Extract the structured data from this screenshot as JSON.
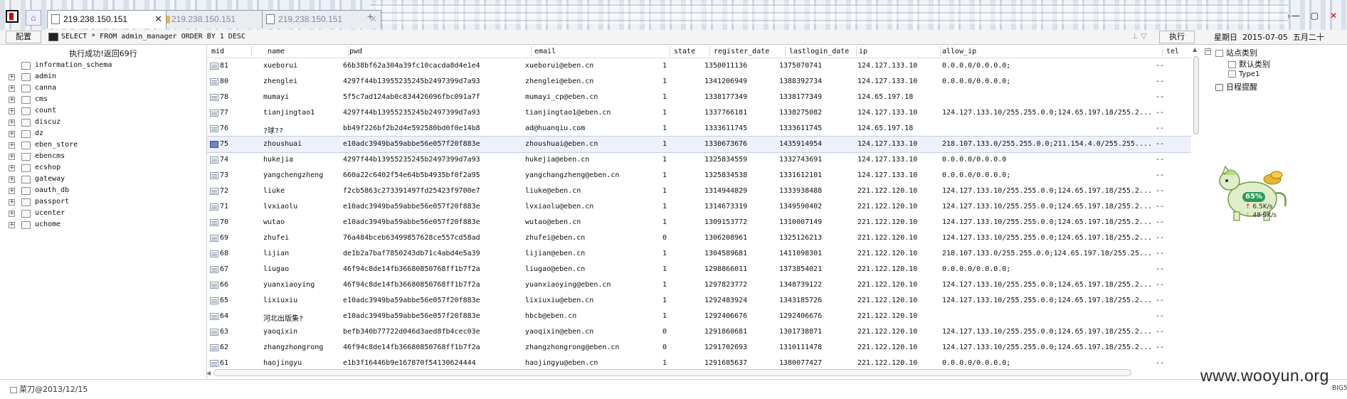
{
  "tabs": [
    {
      "label": "219.238.150.151",
      "icon": "document-icon",
      "active": true
    },
    {
      "label": "219.238.150.151",
      "icon": "folder-icon",
      "active": false
    },
    {
      "label": "219.238.150.151",
      "icon": "document-icon",
      "active": false
    }
  ],
  "toolbar": {
    "config_label": "配置",
    "sql": "SELECT * FROM admin_manager ORDER BY 1 DESC",
    "sql_arrows": "⊥ ▽",
    "execute_label": "执行",
    "date": "星期日  2015-07-05  五月二十"
  },
  "status": {
    "message": "执行成功!返回69行"
  },
  "databases": [
    "information_schema",
    "admin",
    "canna",
    "cms",
    "count",
    "discuz",
    "dz",
    "eben_store",
    "ebencms",
    "ecshop",
    "gateway",
    "oauth_db",
    "passport",
    "ucenter",
    "uchome"
  ],
  "grid": {
    "columns": [
      "mid",
      "name",
      "pwd",
      "email",
      "state",
      "register_date",
      "lastlogin_date",
      "ip",
      "allow_ip",
      "tel"
    ],
    "selected_row": 5,
    "rows": [
      [
        "81",
        "xueborui",
        "66b38bf62a304a39fc10cacda8d4e1e4",
        "xueborui@eben.cn",
        "1",
        "1350011136",
        "1375070741",
        "124.127.133.10",
        "0.0.0.0/0.0.0.0;",
        "--"
      ],
      [
        "80",
        "zhenglei",
        "4297f44b13955235245b2497399d7a93",
        "zhenglei@eben.cn",
        "1",
        "1341206949",
        "1388392734",
        "124.127.133.10",
        "0.0.0.0/0.0.0.0;",
        "--"
      ],
      [
        "78",
        "mumayi",
        "5f5c7ad124ab0c834426096fbc091a7f",
        "mumayi_cp@eben.cn",
        "1",
        "1338177349",
        "1338177349",
        "124.65.197.18",
        "",
        "--"
      ],
      [
        "77",
        "tianjingtao1",
        "4297f44b13955235245b2497399d7a93",
        "tianjingtao1@eben.cn",
        "1",
        "1337766181",
        "1338275082",
        "124.127.133.10",
        "124.127.133.10/255.255.0.0;124.65.197.18/255.2...",
        "--"
      ],
      [
        "76",
        "?球??",
        "bb49f226bf2b2d4e592580bd0f0e14b8",
        "ad@huanqiu.com",
        "1",
        "1333611745",
        "1333611745",
        "124.65.197.18",
        "",
        "--"
      ],
      [
        "75",
        "zhoushuai",
        "e10adc3949ba59abbe56e057f20f883e",
        "zhoushuai@eben.cn",
        "1",
        "1330673676",
        "1435914954",
        "124.127.133.10",
        "218.107.133.0/255.255.0.0;211.154.4.0/255.255....",
        "--"
      ],
      [
        "74",
        "hukejia",
        "4297f44b13955235245b2497399d7a93",
        "hukejia@eben.cn",
        "1",
        "1325834559",
        "1332743691",
        "124.127.133.10",
        "0.0.0.0/0.0.0.0",
        "--"
      ],
      [
        "73",
        "yangchengzheng",
        "660a22c6402f54e64b5b4935bf0f2a95",
        "yangchangzheng@eben.cn",
        "1",
        "1325834538",
        "1331612101",
        "124.127.133.10",
        "0.0.0.0/0.0.0.0;",
        "--"
      ],
      [
        "72",
        "liuke",
        "f2cb5863c273391497fd25423f9700e7",
        "liuke@eben.cn",
        "1",
        "1314944829",
        "1333938488",
        "221.122.120.10",
        "124.127.133.10/255.255.0.0;124.65.197.18/255.2...",
        "--"
      ],
      [
        "71",
        "lvxiaolu",
        "e10adc3949ba59abbe56e057f20f883e",
        "lvxiaolu@eben.cn",
        "1",
        "1314673319",
        "1349590402",
        "221.122.120.10",
        "124.127.133.10/255.255.0.0;124.65.197.18/255.2...",
        "--"
      ],
      [
        "70",
        "wutao",
        "e10adc3949ba59abbe56e057f20f883e",
        "wutao@eben.cn",
        "1",
        "1309153772",
        "1310007149",
        "221.122.120.10",
        "124.127.133.10/255.255.0.0;124.65.197.18/255.2...",
        "--"
      ],
      [
        "69",
        "zhufei",
        "76a484bceb63499857628ce557cd58ad",
        "zhufei@eben.cn",
        "0",
        "1306208961",
        "1325126213",
        "221.122.120.10",
        "124.127.133.10/255.255.0.0;124.65.197.18/255.2...",
        "--"
      ],
      [
        "68",
        "lijian",
        "de1b2a7baf7850243db71c4abd4e5a39",
        "lijian@eben.cn",
        "1",
        "1304589681",
        "1411098301",
        "221.122.120.10",
        "218.107.133.0/255.255.0.0;124.65.197.18/255.25...",
        "--"
      ],
      [
        "67",
        "liugao",
        "46f94c8de14fb36680850768ff1b7f2a",
        "liugao@eben.cn",
        "1",
        "1298866011",
        "1373854021",
        "221.122.120.10",
        "0.0.0.0/0.0.0.0;",
        "--"
      ],
      [
        "66",
        "yuanxiaoying",
        "46f94c8de14fb36680850768ff1b7f2a",
        "yuanxiaoying@eben.cn",
        "1",
        "1297823772",
        "1348739122",
        "221.122.120.10",
        "124.127.133.10/255.255.0.0;124.65.197.18/255.2...",
        "--"
      ],
      [
        "65",
        "lixiuxiu",
        "e10adc3949ba59abbe56e057f20f883e",
        "lixiuxiu@eben.cn",
        "1",
        "1292483924",
        "1343185726",
        "221.122.120.10",
        "124.127.133.10/255.255.0.0;124.65.197.18/255.2...",
        "--"
      ],
      [
        "64",
        "河北出版集?",
        "e10adc3949ba59abbe56e057f20f883e",
        "hbcb@eben.cn",
        "1",
        "1292406676",
        "1292406676",
        "221.122.120.10",
        "",
        "--"
      ],
      [
        "63",
        "yaoqixin",
        "befb340b77722d046d3aed8fb4cec03e",
        "yaoqixin@eben.cn",
        "0",
        "1291860681",
        "1301738871",
        "221.122.120.10",
        "124.127.133.10/255.255.0.0;124.65.197.18/255.2...",
        "--"
      ],
      [
        "62",
        "zhangzhongrong",
        "46f94c8de14fb36680850768ff1b7f2a",
        "zhangzhongrong@eben.cn",
        "0",
        "1291702693",
        "1310111478",
        "221.122.120.10",
        "124.127.133.10/255.255.0.0;124.65.197.18/255.2...",
        "--"
      ],
      [
        "61",
        "haojingyu",
        "e1b3f16446b9e167870f54130624444",
        "haojingyu@eben.cn",
        "1",
        "1291685637",
        "1380077427",
        "221.122.120.10",
        "0.0.0.0/0.0.0.0;",
        "--"
      ]
    ]
  },
  "right_panel": {
    "category_root": "站点类别",
    "categories": [
      "默认类别",
      "Type1"
    ],
    "reminder": "日程提醒"
  },
  "speed": {
    "percent": "65%",
    "up": "6.5K/s",
    "down": "48.9K/s"
  },
  "footer": {
    "text": "菜刀@2013/12/15",
    "encoding": "BIG5"
  },
  "watermark": "www.wooyun.org",
  "window_controls": {
    "scroll": "›",
    "minimize": "—",
    "maximize": "▢",
    "close": "✕"
  },
  "colors": {
    "selected_row": "#eef1fa",
    "accent_green": "#2c9b5a"
  }
}
